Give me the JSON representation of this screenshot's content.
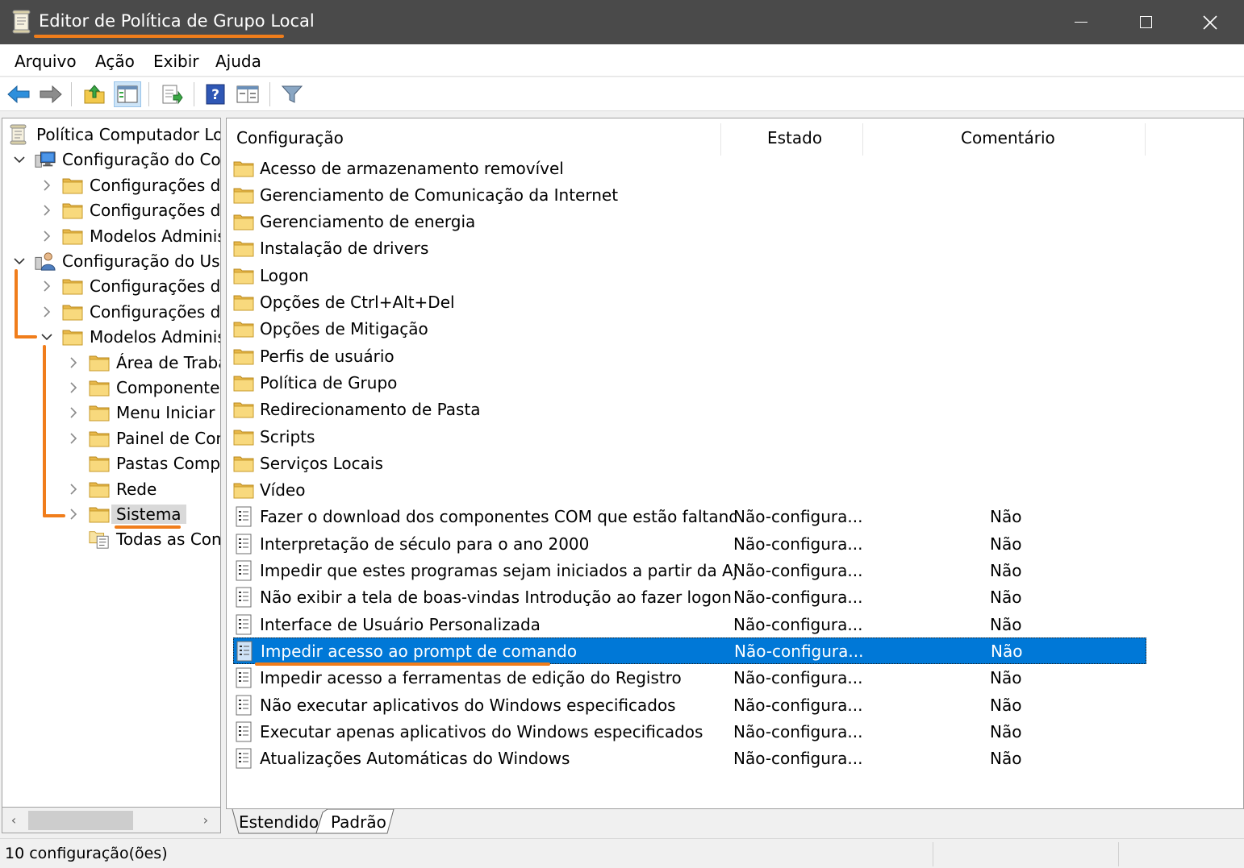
{
  "window": {
    "title": "Editor de Política de Grupo Local",
    "icons": {
      "app": "policy-scroll-icon"
    }
  },
  "menu": [
    {
      "label": "Arquivo"
    },
    {
      "label": "Ação"
    },
    {
      "label": "Exibir"
    },
    {
      "label": "Ajuda"
    }
  ],
  "toolbar": {
    "icons": [
      "back-arrow-icon",
      "forward-arrow-icon",
      "up-folder-icon",
      "show-hide-tree-icon",
      "export-list-icon",
      "help-icon",
      "extended-view-icon",
      "filter-icon"
    ]
  },
  "tree": [
    {
      "label": "Política Computador Local",
      "level": 0,
      "expander": "none",
      "icon": "policy-scroll-icon"
    },
    {
      "label": "Configuração do Computador",
      "level": 1,
      "expander": "expanded",
      "icon": "computer-icon"
    },
    {
      "label": "Configurações de Software",
      "level": 2,
      "expander": "collapsed",
      "icon": "folder-icon"
    },
    {
      "label": "Configurações do Windows",
      "level": 2,
      "expander": "collapsed",
      "icon": "folder-icon"
    },
    {
      "label": "Modelos Administrativos",
      "level": 2,
      "expander": "collapsed",
      "icon": "folder-icon"
    },
    {
      "label": "Configuração do Usuário",
      "level": 1,
      "expander": "expanded",
      "icon": "user-icon"
    },
    {
      "label": "Configurações de Software",
      "level": 2,
      "expander": "collapsed",
      "icon": "folder-icon"
    },
    {
      "label": "Configurações do Windows",
      "level": 2,
      "expander": "collapsed",
      "icon": "folder-icon"
    },
    {
      "label": "Modelos Administrativos",
      "level": 2,
      "expander": "expanded",
      "icon": "folder-icon"
    },
    {
      "label": "Área de Trabalho",
      "level": 3,
      "expander": "collapsed",
      "icon": "folder-icon"
    },
    {
      "label": "Componentes do Windows",
      "level": 3,
      "expander": "collapsed",
      "icon": "folder-icon"
    },
    {
      "label": "Menu Iniciar e Barra de Tarefas",
      "level": 3,
      "expander": "collapsed",
      "icon": "folder-icon"
    },
    {
      "label": "Painel de Controle",
      "level": 3,
      "expander": "collapsed",
      "icon": "folder-icon"
    },
    {
      "label": "Pastas Compartilhadas",
      "level": 3,
      "expander": "none",
      "icon": "folder-icon"
    },
    {
      "label": "Rede",
      "level": 3,
      "expander": "collapsed",
      "icon": "folder-icon"
    },
    {
      "label": "Sistema",
      "level": 3,
      "expander": "collapsed",
      "icon": "folder-icon",
      "selected": true
    },
    {
      "label": "Todas as Configurações",
      "level": 3,
      "expander": "none",
      "icon": "all-settings-icon"
    }
  ],
  "list": {
    "columns": [
      "Configuração",
      "Estado",
      "Comentário"
    ],
    "rows": [
      {
        "name": "Acesso de armazenamento removível",
        "state": "",
        "comment": "",
        "icon": "folder-icon"
      },
      {
        "name": "Gerenciamento de Comunicação da Internet",
        "state": "",
        "comment": "",
        "icon": "folder-icon"
      },
      {
        "name": "Gerenciamento de energia",
        "state": "",
        "comment": "",
        "icon": "folder-icon"
      },
      {
        "name": "Instalação de drivers",
        "state": "",
        "comment": "",
        "icon": "folder-icon"
      },
      {
        "name": "Logon",
        "state": "",
        "comment": "",
        "icon": "folder-icon"
      },
      {
        "name": "Opções de Ctrl+Alt+Del",
        "state": "",
        "comment": "",
        "icon": "folder-icon"
      },
      {
        "name": "Opções de Mitigação",
        "state": "",
        "comment": "",
        "icon": "folder-icon"
      },
      {
        "name": "Perfis de usuário",
        "state": "",
        "comment": "",
        "icon": "folder-icon"
      },
      {
        "name": "Política de Grupo",
        "state": "",
        "comment": "",
        "icon": "folder-icon"
      },
      {
        "name": "Redirecionamento de Pasta",
        "state": "",
        "comment": "",
        "icon": "folder-icon"
      },
      {
        "name": "Scripts",
        "state": "",
        "comment": "",
        "icon": "folder-icon"
      },
      {
        "name": "Serviços Locais",
        "state": "",
        "comment": "",
        "icon": "folder-icon"
      },
      {
        "name": "Vídeo",
        "state": "",
        "comment": "",
        "icon": "folder-icon"
      },
      {
        "name": "Fazer o download dos componentes COM que estão faltando",
        "state": "Não-configura...",
        "comment": "Não",
        "icon": "policy-setting-icon"
      },
      {
        "name": "Interpretação de século para o ano 2000",
        "state": "Não-configura...",
        "comment": "Não",
        "icon": "policy-setting-icon"
      },
      {
        "name": "Impedir que estes programas sejam iniciados a partir da Ajuda",
        "state": "Não-configura...",
        "comment": "Não",
        "icon": "policy-setting-icon"
      },
      {
        "name": "Não exibir a tela de boas-vindas Introdução ao fazer logon",
        "state": "Não-configura...",
        "comment": "Não",
        "icon": "policy-setting-icon"
      },
      {
        "name": "Interface de Usuário Personalizada",
        "state": "Não-configura...",
        "comment": "Não",
        "icon": "policy-setting-icon"
      },
      {
        "name": "Impedir acesso ao prompt de comando",
        "state": "Não-configura...",
        "comment": "Não",
        "icon": "policy-setting-icon",
        "selected": true
      },
      {
        "name": "Impedir acesso a ferramentas de edição do Registro",
        "state": "Não-configura...",
        "comment": "Não",
        "icon": "policy-setting-icon"
      },
      {
        "name": "Não executar aplicativos do Windows especificados",
        "state": "Não-configura...",
        "comment": "Não",
        "icon": "policy-setting-icon"
      },
      {
        "name": "Executar apenas aplicativos do Windows especificados",
        "state": "Não-configura...",
        "comment": "Não",
        "icon": "policy-setting-icon"
      },
      {
        "name": "Atualizações Automáticas do Windows",
        "state": "Não-configura...",
        "comment": "Não",
        "icon": "policy-setting-icon"
      }
    ]
  },
  "tabs": [
    {
      "label": "Estendido",
      "active": false
    },
    {
      "label": "Padrão",
      "active": true
    }
  ],
  "status": {
    "text": "10 configuração(ões)"
  },
  "colors": {
    "accent": "#0078d7",
    "annotation": "#f07d1b",
    "titlebar": "#4a4a4a",
    "folder": "#f5d37a"
  }
}
